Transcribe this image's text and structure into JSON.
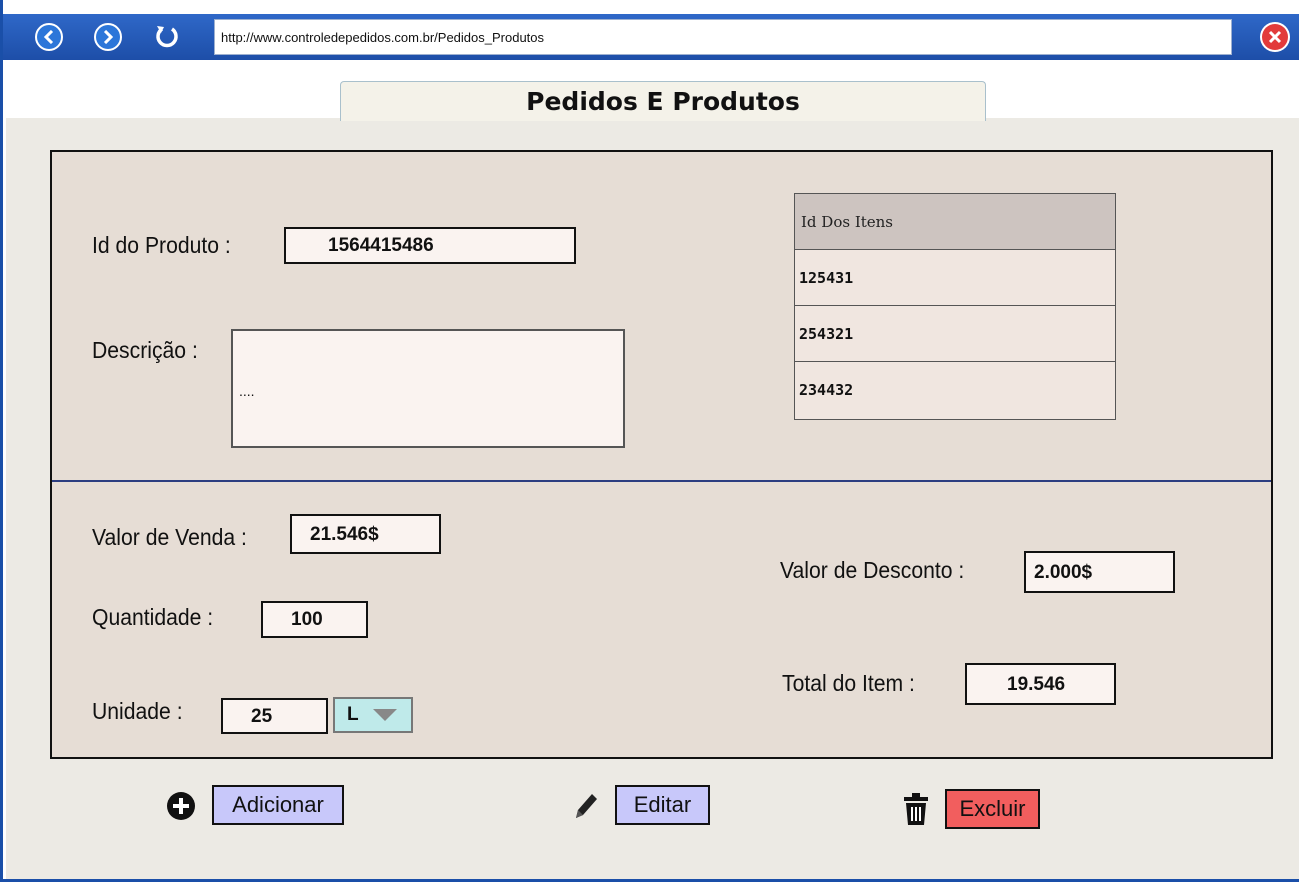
{
  "browser": {
    "url": "http://www.controledepedidos.com.br/Pedidos_Produtos",
    "back_icon": "back-arrow-icon",
    "forward_icon": "forward-arrow-icon",
    "reload_icon": "reload-icon",
    "close_icon": "close-icon"
  },
  "page": {
    "title": "Pedidos E Produtos"
  },
  "form": {
    "id_produto": {
      "label": "Id do Produto :",
      "value": "1564415486"
    },
    "descricao": {
      "label": "Descrição :",
      "value": "...."
    },
    "itens_table": {
      "header": "Id Dos Itens",
      "rows": [
        "125431",
        "254321",
        "234432"
      ]
    },
    "valor_venda": {
      "label": "Valor de Venda :",
      "value": "21.546$"
    },
    "valor_desconto": {
      "label": "Valor de Desconto :",
      "value": "2.000$"
    },
    "quantidade": {
      "label": "Quantidade :",
      "value": "100"
    },
    "total_item": {
      "label": "Total do Item :",
      "value": "19.546"
    },
    "unidade": {
      "label": "Unidade :",
      "value": "25",
      "unit_selected": "L"
    }
  },
  "actions": {
    "adicionar": "Adicionar",
    "editar": "Editar",
    "excluir": "Excluir"
  },
  "colors": {
    "toolbar": "#1d4ea8",
    "panel": "#e6ddd5",
    "button_blue": "#c8c8fa",
    "button_red": "#f25e5e",
    "select": "#bfeaea"
  }
}
